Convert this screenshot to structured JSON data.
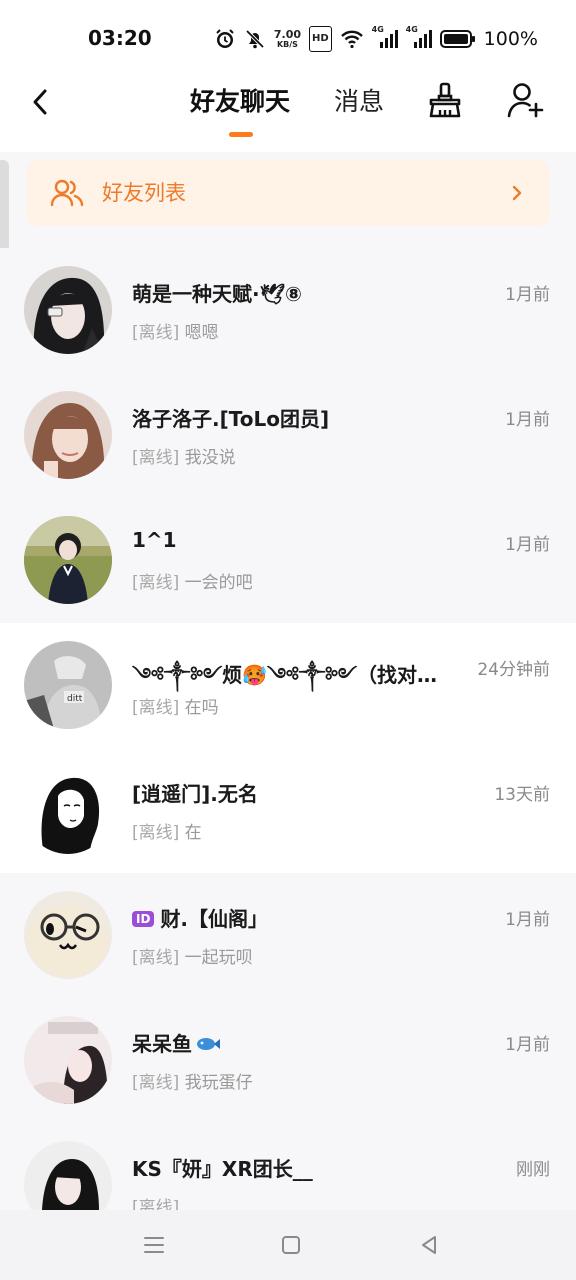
{
  "status_bar": {
    "time": "03:20",
    "net_speed_value": "7.00",
    "net_speed_unit": "KB/S",
    "hd_label": "HD",
    "signal_label_1": "4G",
    "signal_label_2": "4G",
    "battery": "100%"
  },
  "header": {
    "tab_friends": "好友聊天",
    "tab_messages": "消息",
    "accent_color": "#ff7a1a"
  },
  "friend_list_banner": {
    "label": "好友列表"
  },
  "chats": [
    {
      "name": "萌是一种天赋·🕊⑧",
      "time": "1月前",
      "status": "[离线]",
      "message": "嗯嗯"
    },
    {
      "name": "洛子洛子.[ToLo团员]",
      "time": "1月前",
      "status": "[离线]",
      "message": "我没说"
    },
    {
      "name": "1^1",
      "time": "1月前",
      "status": "[离线]",
      "message": "一会的吧"
    },
    {
      "name": "༺༒༻烦🥵༺༒༻（找对…",
      "time": "24分钟前",
      "status": "[离线]",
      "message": "在吗"
    },
    {
      "name": "[逍遥门].无名",
      "time": "13天前",
      "status": "[离线]",
      "message": "在"
    },
    {
      "id_badge": "ID",
      "name": "财.【仙阁」",
      "time": "1月前",
      "status": "[离线]",
      "message": "一起玩呗"
    },
    {
      "name": "呆呆鱼",
      "time": "1月前",
      "status": "[离线]",
      "message": "我玩蛋仔"
    },
    {
      "name": "KS『妍』XR团长__",
      "time": "刚刚",
      "status": "[离线]",
      "message": ""
    }
  ]
}
